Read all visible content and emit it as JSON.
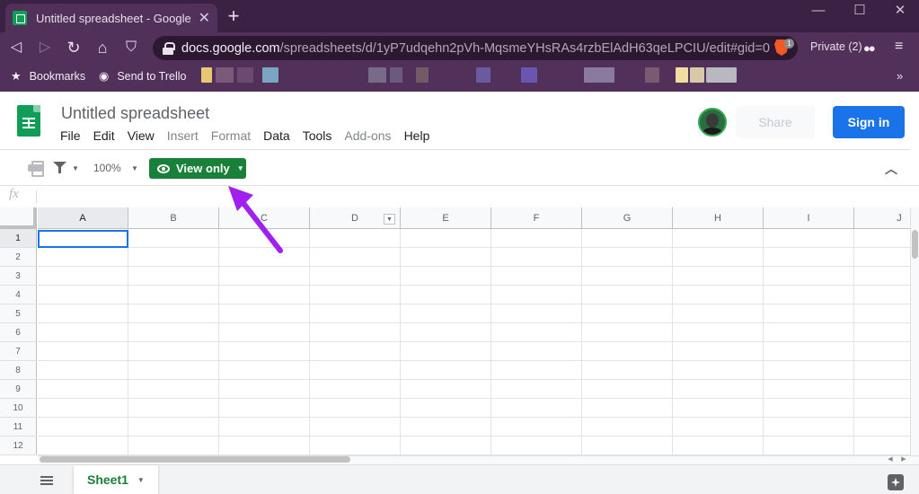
{
  "browser": {
    "tab_title": "Untitled spreadsheet - Google Sheets",
    "tab_close": "✕",
    "new_tab": "+",
    "window_buttons": [
      "—",
      "☐",
      "✕"
    ],
    "nav": {
      "back": "◁",
      "forward": "▷",
      "reload": "↻",
      "home": "⌂",
      "bookmark": "⛉"
    },
    "url_host": "docs.google.com",
    "url_path": "/spreadsheets/d/1yP7udqehn2pVh-MqsmeYHsRAs4rzbElAdH63qeLPCIU/edit#gid=0",
    "shield_count": "1",
    "private_label": "Private (2)",
    "menu_icon": "≡",
    "bookmarks": [
      {
        "label": "Bookmarks",
        "icon": "star-icon",
        "glyph": "★"
      },
      {
        "label": "Send to Trello",
        "icon": "globe-icon",
        "glyph": "◉"
      }
    ],
    "bookmarks_overflow": "»"
  },
  "sheets": {
    "title": "Untitled spreadsheet",
    "menu": [
      {
        "label": "File",
        "disabled": false
      },
      {
        "label": "Edit",
        "disabled": false
      },
      {
        "label": "View",
        "disabled": false
      },
      {
        "label": "Insert",
        "disabled": true
      },
      {
        "label": "Format",
        "disabled": true
      },
      {
        "label": "Data",
        "disabled": false
      },
      {
        "label": "Tools",
        "disabled": false
      },
      {
        "label": "Add-ons",
        "disabled": true
      },
      {
        "label": "Help",
        "disabled": false
      }
    ],
    "share_label": "Share",
    "signin_label": "Sign in",
    "zoom": "100%",
    "view_only_label": "View only",
    "fx_label": "fx",
    "formula_value": "",
    "columns": [
      "A",
      "B",
      "C",
      "D",
      "E",
      "F",
      "G",
      "H",
      "I",
      "J"
    ],
    "rows": [
      "1",
      "2",
      "3",
      "4",
      "5",
      "6",
      "7",
      "8",
      "9",
      "10",
      "11",
      "12"
    ],
    "active_cell": "A1",
    "sheet_tab": "Sheet1"
  },
  "colors": {
    "chrome_dark": "#3b2245",
    "chrome": "#513059",
    "sheets_green": "#188038",
    "signin_blue": "#1a73e8",
    "annotation_arrow": "#a020f0"
  }
}
